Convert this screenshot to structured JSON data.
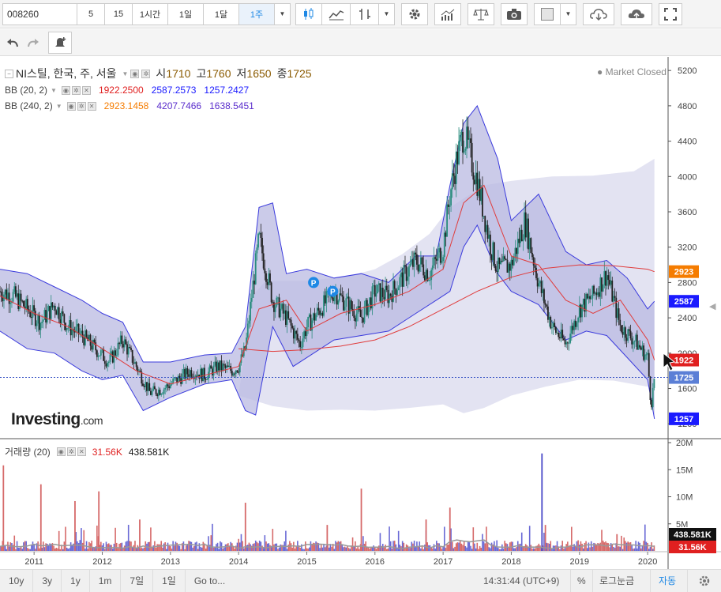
{
  "toolbar": {
    "symbol": "008260",
    "intervals": [
      "5",
      "15",
      "1시간",
      "1일",
      "1달",
      "1주"
    ],
    "active_interval": "1주",
    "icons": [
      "candles-icon",
      "area-chart-icon",
      "bars-icon",
      "settings-icon",
      "indicators-icon",
      "balance-icon",
      "camera-icon",
      "color-box-icon",
      "cloud-download-icon",
      "cloud-upload-icon",
      "fullscreen-icon"
    ]
  },
  "toolbar2": {
    "icons": [
      "undo-icon",
      "redo-icon",
      "alert-add-icon"
    ]
  },
  "main_legend": {
    "title": "NI스틸, 한국, 주, 서울",
    "open_label": "시",
    "open": "1710",
    "high_label": "고",
    "high": "1760",
    "low_label": "저",
    "low": "1650",
    "close_label": "종",
    "close": "1725"
  },
  "market_status": "Market Closed",
  "bb20": {
    "label": "BB (20, 2)",
    "mid": "1922.2500",
    "upper": "2587.2573",
    "lower": "1257.2427"
  },
  "bb240": {
    "label": "BB (240, 2)",
    "mid": "2923.1458",
    "upper": "4207.7466",
    "lower": "1638.5451"
  },
  "volume": {
    "label": "거래량 (20)",
    "value": "31.56K",
    "avg": "438.581K"
  },
  "logo": {
    "main": "Investing",
    "suffix": ".com"
  },
  "bottombar": {
    "ranges": [
      "10y",
      "3y",
      "1y",
      "1m",
      "7일",
      "1일",
      "Go to..."
    ],
    "time": "14:31:44 (UTC+9)",
    "percent": "%",
    "log": "로그눈금",
    "auto": "자동"
  },
  "price_axis": [
    "5200",
    "4800",
    "4400",
    "4000",
    "3600",
    "3200",
    "2800",
    "2400",
    "2000",
    "1600",
    "1200"
  ],
  "volume_axis": [
    "20M",
    "15M",
    "10M",
    "5M"
  ],
  "axis_tags": [
    {
      "value": "2923",
      "color": "#f57c00"
    },
    {
      "value": "2587",
      "color": "#1a1aff"
    },
    {
      "value": "1922",
      "color": "#e02020"
    },
    {
      "value": "1725",
      "color": "#5b7fd6"
    },
    {
      "value": "1257",
      "color": "#1a1aff"
    }
  ],
  "volume_tags": [
    {
      "value": "438.581K",
      "color": "#111111"
    },
    {
      "value": "31.56K",
      "color": "#e02020"
    }
  ],
  "chart_data": {
    "type": "line",
    "title": "NI스틸, 한국, 주, 서울",
    "x_ticks": [
      "2011",
      "2012",
      "2013",
      "2014",
      "2015",
      "2016",
      "2017",
      "2018",
      "2019",
      "2020"
    ],
    "ylim": [
      1200,
      5200
    ],
    "series": [
      {
        "name": "close",
        "x": [
          2010.5,
          2010.7,
          2010.9,
          2011.1,
          2011.3,
          2011.5,
          2011.7,
          2011.9,
          2012.1,
          2012.3,
          2012.5,
          2012.7,
          2012.9,
          2013.1,
          2013.3,
          2013.5,
          2013.7,
          2013.9,
          2014.0,
          2014.1,
          2014.2,
          2014.3,
          2014.5,
          2014.7,
          2014.9,
          2015.0,
          2015.2,
          2015.4,
          2015.6,
          2015.8,
          2016.0,
          2016.2,
          2016.4,
          2016.6,
          2016.8,
          2017.0,
          2017.1,
          2017.2,
          2017.3,
          2017.5,
          2017.7,
          2017.8,
          2018.0,
          2018.2,
          2018.4,
          2018.6,
          2018.8,
          2019.0,
          2019.2,
          2019.4,
          2019.6,
          2019.8,
          2020.0,
          2020.05,
          2020.1
        ],
        "values": [
          2700,
          2650,
          2500,
          2350,
          2550,
          2300,
          2200,
          2050,
          1900,
          2150,
          1850,
          1550,
          1600,
          1700,
          1800,
          1750,
          1850,
          1800,
          1850,
          2050,
          2700,
          3300,
          2600,
          2400,
          2100,
          2300,
          2500,
          2700,
          2550,
          2400,
          2700,
          2650,
          2850,
          3050,
          2900,
          3200,
          3800,
          4200,
          4500,
          3950,
          3200,
          2950,
          3000,
          3500,
          2800,
          2300,
          2100,
          2500,
          2650,
          2900,
          2300,
          2150,
          1950,
          1400,
          1725
        ]
      },
      {
        "name": "BB (20, 2) basis",
        "x": [
          2010.5,
          2011.0,
          2011.5,
          2012.0,
          2012.5,
          2013.0,
          2013.5,
          2014.0,
          2014.3,
          2014.7,
          2015.0,
          2015.5,
          2016.0,
          2016.5,
          2017.0,
          2017.3,
          2017.6,
          2018.0,
          2018.4,
          2018.8,
          2019.2,
          2019.6,
          2020.0,
          2020.1
        ],
        "values": [
          2650,
          2450,
          2300,
          2050,
          1800,
          1650,
          1750,
          1850,
          2500,
          2600,
          2250,
          2450,
          2550,
          2700,
          2950,
          3700,
          3900,
          3100,
          3000,
          2600,
          2450,
          2600,
          2150,
          1922
        ]
      },
      {
        "name": "BB (240, 2) basis",
        "x": [
          2014.0,
          2014.5,
          2015.0,
          2015.5,
          2016.0,
          2016.5,
          2017.0,
          2017.5,
          2018.0,
          2018.5,
          2019.0,
          2019.5,
          2020.0,
          2020.1
        ],
        "values": [
          2050,
          2020,
          2040,
          2080,
          2150,
          2300,
          2500,
          2700,
          2860,
          2960,
          3000,
          2990,
          2950,
          2923
        ]
      }
    ],
    "volume": {
      "ylim": [
        0,
        20000000
      ],
      "x": [
        2010.55,
        2011.1,
        2011.6,
        2011.95,
        2012.55,
        2014.1,
        2015.3,
        2015.8,
        2016.75,
        2017.1,
        2018.45,
        2018.5,
        2019.55
      ],
      "values": [
        15800000,
        12300000,
        9200000,
        11000000,
        5800000,
        8900000,
        4800000,
        11500000,
        5800000,
        8000000,
        18000000,
        4800000,
        3100000
      ]
    }
  }
}
